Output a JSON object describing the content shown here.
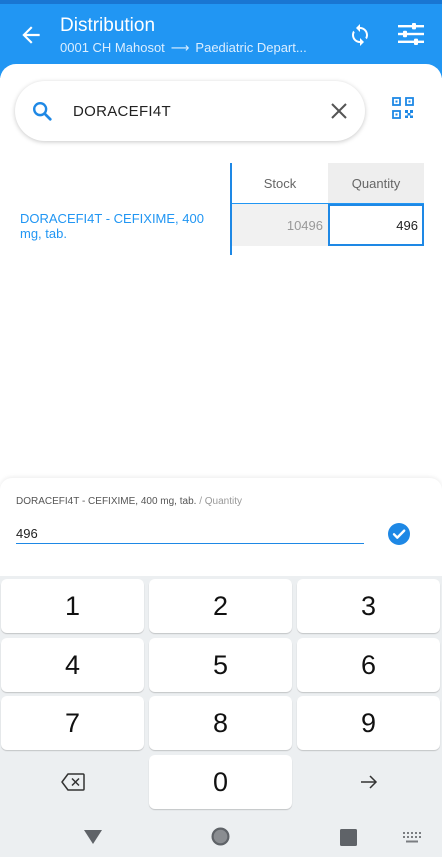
{
  "appbar": {
    "title": "Distribution",
    "from": "0001 CH Mahosot",
    "arrow": "⟶",
    "to": "Paediatric Depart..."
  },
  "search": {
    "query": "DORACEFI4T",
    "icon": "search-icon",
    "clear_icon": "close-icon"
  },
  "table": {
    "columns": [
      "Stock",
      "Quantity"
    ],
    "rows": [
      {
        "product": "DORACEFI4T - CEFIXIME, 400 mg, tab.",
        "stock": "10496",
        "quantity": "496"
      }
    ]
  },
  "entry": {
    "product": "DORACEFI4T - CEFIXIME, 400 mg, tab.",
    "separator": " / ",
    "field": "Quantity",
    "value": "496"
  },
  "keyboard": {
    "keys": [
      "1",
      "2",
      "3",
      "4",
      "5",
      "6",
      "7",
      "8",
      "9",
      "0"
    ]
  },
  "colors": {
    "primary": "#2196f3",
    "primary_dark": "#1976d2"
  }
}
